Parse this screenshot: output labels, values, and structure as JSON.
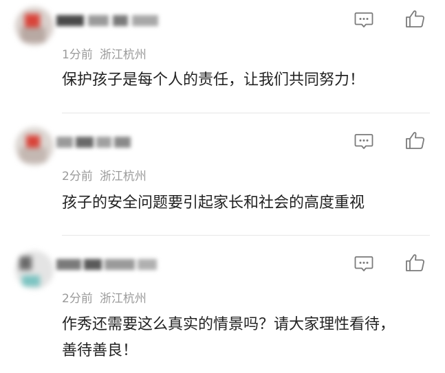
{
  "comments": [
    {
      "username": "",
      "time": "1分前",
      "location": "浙江杭州",
      "text": "保护孩子是每个人的责任，让我们共同努力！",
      "reply_icon": "comment-bubble-icon",
      "like_icon": "thumbs-up-icon"
    },
    {
      "username": "",
      "time": "2分前",
      "location": "浙江杭州",
      "text": "孩子的安全问题要引起家长和社会的高度重视",
      "reply_icon": "comment-bubble-icon",
      "like_icon": "thumbs-up-icon"
    },
    {
      "username": "",
      "time": "2分前",
      "location": "浙江杭州",
      "text": "作秀还需要这么真实的情景吗？请大家理性看待，善待善良！",
      "reply_icon": "comment-bubble-icon",
      "like_icon": "thumbs-up-icon"
    }
  ],
  "colors": {
    "text": "#222222",
    "meta": "#9a9a9a",
    "icon": "#7a7a7a",
    "divider": "#e6e6e6"
  }
}
